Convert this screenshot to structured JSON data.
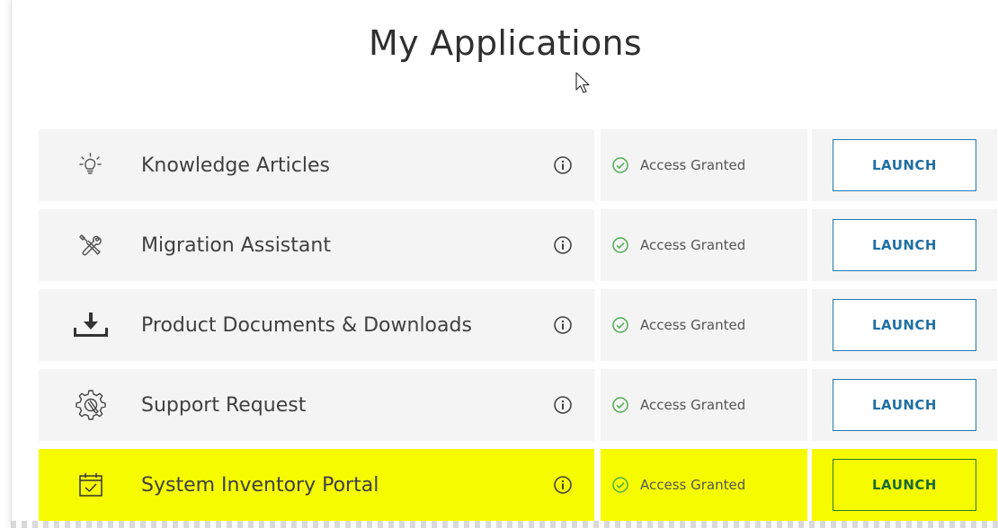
{
  "page": {
    "title": "My Applications"
  },
  "applications": [
    {
      "name": "Knowledge Articles",
      "icon": "lightbulb-icon",
      "status": "Access Granted",
      "action": "LAUNCH",
      "highlighted": false
    },
    {
      "name": "Migration Assistant",
      "icon": "tools-icon",
      "status": "Access Granted",
      "action": "LAUNCH",
      "highlighted": false
    },
    {
      "name": "Product Documents & Downloads",
      "icon": "download-icon",
      "status": "Access Granted",
      "action": "LAUNCH",
      "highlighted": false
    },
    {
      "name": "Support Request",
      "icon": "gear-wrench-icon",
      "status": "Access Granted",
      "action": "LAUNCH",
      "highlighted": false
    },
    {
      "name": "System Inventory Portal",
      "icon": "calendar-check-icon",
      "status": "Access Granted",
      "action": "LAUNCH",
      "highlighted": true
    }
  ],
  "colors": {
    "row_background": "#f4f4f4",
    "highlight": "#f6fb00",
    "button_border": "#1f7ab3",
    "status_check": "#4caf50"
  }
}
